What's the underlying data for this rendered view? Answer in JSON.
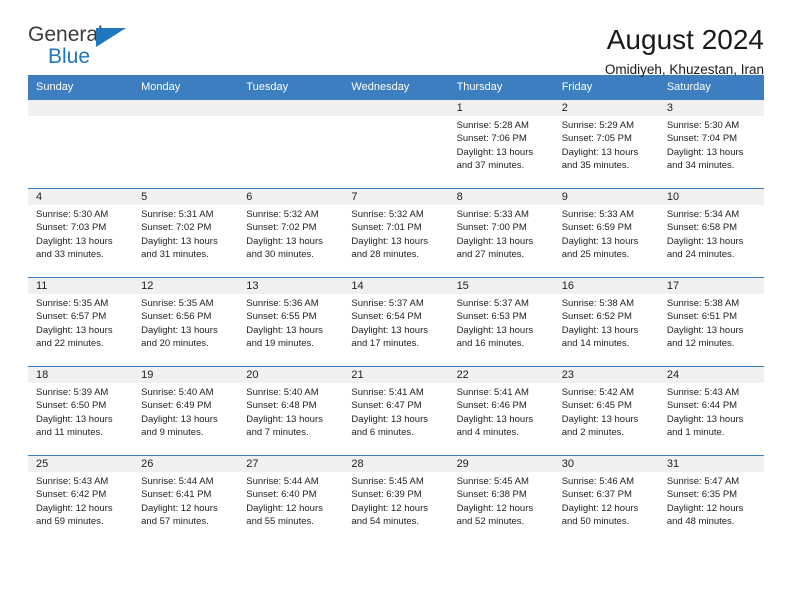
{
  "brand": {
    "name_top": "General",
    "name_bottom": "Blue",
    "color_blue": "#1f77bd",
    "color_dark": "#3b3b3b",
    "triangle_icon": "triangle-icon"
  },
  "header": {
    "title": "August 2024",
    "location": "Omidiyeh, Khuzestan, Iran"
  },
  "calendar": {
    "header_bg": "#3c7ebf",
    "daynum_bg": "#f0f0f0",
    "weekdays": [
      "Sunday",
      "Monday",
      "Tuesday",
      "Wednesday",
      "Thursday",
      "Friday",
      "Saturday"
    ],
    "weeks": [
      [
        {
          "day": "",
          "lines": []
        },
        {
          "day": "",
          "lines": []
        },
        {
          "day": "",
          "lines": []
        },
        {
          "day": "",
          "lines": []
        },
        {
          "day": "1",
          "lines": [
            "Sunrise: 5:28 AM",
            "Sunset: 7:06 PM",
            "Daylight: 13 hours",
            "and 37 minutes."
          ]
        },
        {
          "day": "2",
          "lines": [
            "Sunrise: 5:29 AM",
            "Sunset: 7:05 PM",
            "Daylight: 13 hours",
            "and 35 minutes."
          ]
        },
        {
          "day": "3",
          "lines": [
            "Sunrise: 5:30 AM",
            "Sunset: 7:04 PM",
            "Daylight: 13 hours",
            "and 34 minutes."
          ]
        }
      ],
      [
        {
          "day": "4",
          "lines": [
            "Sunrise: 5:30 AM",
            "Sunset: 7:03 PM",
            "Daylight: 13 hours",
            "and 33 minutes."
          ]
        },
        {
          "day": "5",
          "lines": [
            "Sunrise: 5:31 AM",
            "Sunset: 7:02 PM",
            "Daylight: 13 hours",
            "and 31 minutes."
          ]
        },
        {
          "day": "6",
          "lines": [
            "Sunrise: 5:32 AM",
            "Sunset: 7:02 PM",
            "Daylight: 13 hours",
            "and 30 minutes."
          ]
        },
        {
          "day": "7",
          "lines": [
            "Sunrise: 5:32 AM",
            "Sunset: 7:01 PM",
            "Daylight: 13 hours",
            "and 28 minutes."
          ]
        },
        {
          "day": "8",
          "lines": [
            "Sunrise: 5:33 AM",
            "Sunset: 7:00 PM",
            "Daylight: 13 hours",
            "and 27 minutes."
          ]
        },
        {
          "day": "9",
          "lines": [
            "Sunrise: 5:33 AM",
            "Sunset: 6:59 PM",
            "Daylight: 13 hours",
            "and 25 minutes."
          ]
        },
        {
          "day": "10",
          "lines": [
            "Sunrise: 5:34 AM",
            "Sunset: 6:58 PM",
            "Daylight: 13 hours",
            "and 24 minutes."
          ]
        }
      ],
      [
        {
          "day": "11",
          "lines": [
            "Sunrise: 5:35 AM",
            "Sunset: 6:57 PM",
            "Daylight: 13 hours",
            "and 22 minutes."
          ]
        },
        {
          "day": "12",
          "lines": [
            "Sunrise: 5:35 AM",
            "Sunset: 6:56 PM",
            "Daylight: 13 hours",
            "and 20 minutes."
          ]
        },
        {
          "day": "13",
          "lines": [
            "Sunrise: 5:36 AM",
            "Sunset: 6:55 PM",
            "Daylight: 13 hours",
            "and 19 minutes."
          ]
        },
        {
          "day": "14",
          "lines": [
            "Sunrise: 5:37 AM",
            "Sunset: 6:54 PM",
            "Daylight: 13 hours",
            "and 17 minutes."
          ]
        },
        {
          "day": "15",
          "lines": [
            "Sunrise: 5:37 AM",
            "Sunset: 6:53 PM",
            "Daylight: 13 hours",
            "and 16 minutes."
          ]
        },
        {
          "day": "16",
          "lines": [
            "Sunrise: 5:38 AM",
            "Sunset: 6:52 PM",
            "Daylight: 13 hours",
            "and 14 minutes."
          ]
        },
        {
          "day": "17",
          "lines": [
            "Sunrise: 5:38 AM",
            "Sunset: 6:51 PM",
            "Daylight: 13 hours",
            "and 12 minutes."
          ]
        }
      ],
      [
        {
          "day": "18",
          "lines": [
            "Sunrise: 5:39 AM",
            "Sunset: 6:50 PM",
            "Daylight: 13 hours",
            "and 11 minutes."
          ]
        },
        {
          "day": "19",
          "lines": [
            "Sunrise: 5:40 AM",
            "Sunset: 6:49 PM",
            "Daylight: 13 hours",
            "and 9 minutes."
          ]
        },
        {
          "day": "20",
          "lines": [
            "Sunrise: 5:40 AM",
            "Sunset: 6:48 PM",
            "Daylight: 13 hours",
            "and 7 minutes."
          ]
        },
        {
          "day": "21",
          "lines": [
            "Sunrise: 5:41 AM",
            "Sunset: 6:47 PM",
            "Daylight: 13 hours",
            "and 6 minutes."
          ]
        },
        {
          "day": "22",
          "lines": [
            "Sunrise: 5:41 AM",
            "Sunset: 6:46 PM",
            "Daylight: 13 hours",
            "and 4 minutes."
          ]
        },
        {
          "day": "23",
          "lines": [
            "Sunrise: 5:42 AM",
            "Sunset: 6:45 PM",
            "Daylight: 13 hours",
            "and 2 minutes."
          ]
        },
        {
          "day": "24",
          "lines": [
            "Sunrise: 5:43 AM",
            "Sunset: 6:44 PM",
            "Daylight: 13 hours",
            "and 1 minute."
          ]
        }
      ],
      [
        {
          "day": "25",
          "lines": [
            "Sunrise: 5:43 AM",
            "Sunset: 6:42 PM",
            "Daylight: 12 hours",
            "and 59 minutes."
          ]
        },
        {
          "day": "26",
          "lines": [
            "Sunrise: 5:44 AM",
            "Sunset: 6:41 PM",
            "Daylight: 12 hours",
            "and 57 minutes."
          ]
        },
        {
          "day": "27",
          "lines": [
            "Sunrise: 5:44 AM",
            "Sunset: 6:40 PM",
            "Daylight: 12 hours",
            "and 55 minutes."
          ]
        },
        {
          "day": "28",
          "lines": [
            "Sunrise: 5:45 AM",
            "Sunset: 6:39 PM",
            "Daylight: 12 hours",
            "and 54 minutes."
          ]
        },
        {
          "day": "29",
          "lines": [
            "Sunrise: 5:45 AM",
            "Sunset: 6:38 PM",
            "Daylight: 12 hours",
            "and 52 minutes."
          ]
        },
        {
          "day": "30",
          "lines": [
            "Sunrise: 5:46 AM",
            "Sunset: 6:37 PM",
            "Daylight: 12 hours",
            "and 50 minutes."
          ]
        },
        {
          "day": "31",
          "lines": [
            "Sunrise: 5:47 AM",
            "Sunset: 6:35 PM",
            "Daylight: 12 hours",
            "and 48 minutes."
          ]
        }
      ]
    ]
  }
}
